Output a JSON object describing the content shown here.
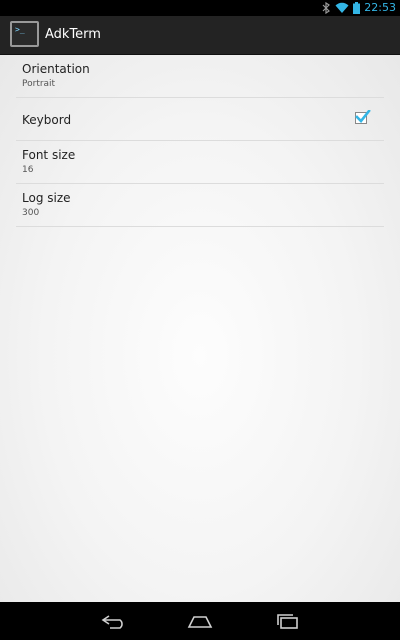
{
  "status": {
    "time": "22:53",
    "accent": "#33b5e5",
    "icons": [
      "bluetooth-icon",
      "wifi-icon",
      "battery-icon"
    ]
  },
  "action_bar": {
    "title": "AdkTerm",
    "icon": "terminal-icon",
    "icon_glyph": ">_"
  },
  "preferences": [
    {
      "title": "Orientation",
      "summary": "Portrait"
    },
    {
      "title": "Keybord",
      "checked": true
    },
    {
      "title": "Font size",
      "summary": "16"
    },
    {
      "title": "Log size",
      "summary": "300"
    }
  ],
  "nav": {
    "buttons": [
      "back-icon",
      "home-icon",
      "recent-apps-icon"
    ]
  }
}
